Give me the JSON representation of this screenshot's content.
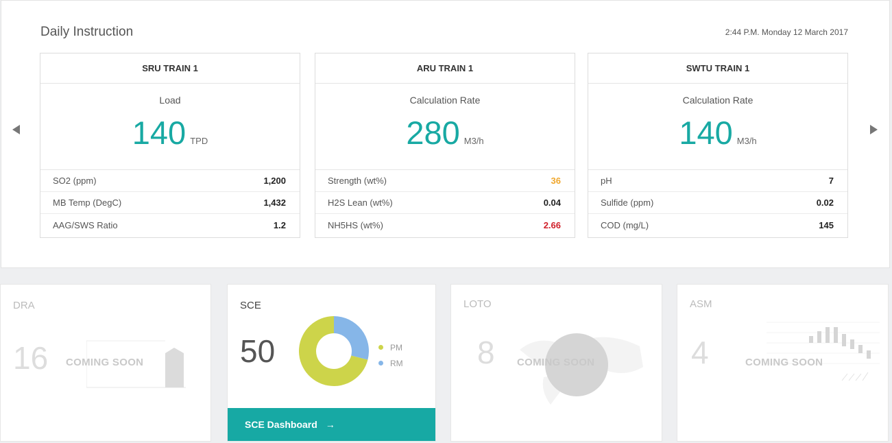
{
  "header": {
    "title": "Daily Instruction",
    "datetime": "2:44 P.M. Monday 12 March 2017"
  },
  "cards": [
    {
      "name": "SRU TRAIN 1",
      "metric_label": "Load",
      "metric_value": "140",
      "metric_unit": "TPD",
      "rows": [
        {
          "label": "SO2 (ppm)",
          "value": "1,200"
        },
        {
          "label": "MB Temp (DegC)",
          "value": "1,432"
        },
        {
          "label": "AAG/SWS Ratio",
          "value": "1.2"
        }
      ]
    },
    {
      "name": "ARU TRAIN 1",
      "metric_label": "Calculation Rate",
      "metric_value": "280",
      "metric_unit": "M3/h",
      "rows": [
        {
          "label": "Strength (wt%)",
          "value": "36",
          "status_color": "#f0a72c"
        },
        {
          "label": "H2S Lean (wt%)",
          "value": "0.04"
        },
        {
          "label": "NH5HS (wt%)",
          "value": "2.66",
          "status_color": "#d0202a"
        }
      ]
    },
    {
      "name": "SWTU TRAIN 1",
      "metric_label": "Calculation Rate",
      "metric_value": "140",
      "metric_unit": "M3/h",
      "rows": [
        {
          "label": "pH",
          "value": "7"
        },
        {
          "label": "Sulfide (ppm)",
          "value": "0.02"
        },
        {
          "label": "COD (mg/L)",
          "value": "145"
        }
      ]
    }
  ],
  "tiles": {
    "dra": {
      "name": "DRA",
      "value": "16",
      "status": "COMING SOON"
    },
    "sce": {
      "name": "SCE",
      "value": "50",
      "footer_label": "SCE Dashboard",
      "footer_icon": "arrow-right-icon",
      "legend": [
        {
          "label": "PM",
          "color": "#cdd44a"
        },
        {
          "label": "RM",
          "color": "#86b6e8"
        }
      ]
    },
    "loto": {
      "name": "LOTO",
      "value": "8",
      "status": "COMING SOON"
    },
    "asm": {
      "name": "ASM",
      "value": "4",
      "status": "COMING SOON"
    }
  },
  "chart_data": {
    "type": "pie",
    "categories": [
      "PM",
      "RM"
    ],
    "values": [
      71,
      29
    ],
    "colors": [
      "#cdd44a",
      "#86b6e8"
    ]
  },
  "colors": {
    "accent": "#18a9a3",
    "warning": "#f0a72c",
    "danger": "#d0202a"
  }
}
